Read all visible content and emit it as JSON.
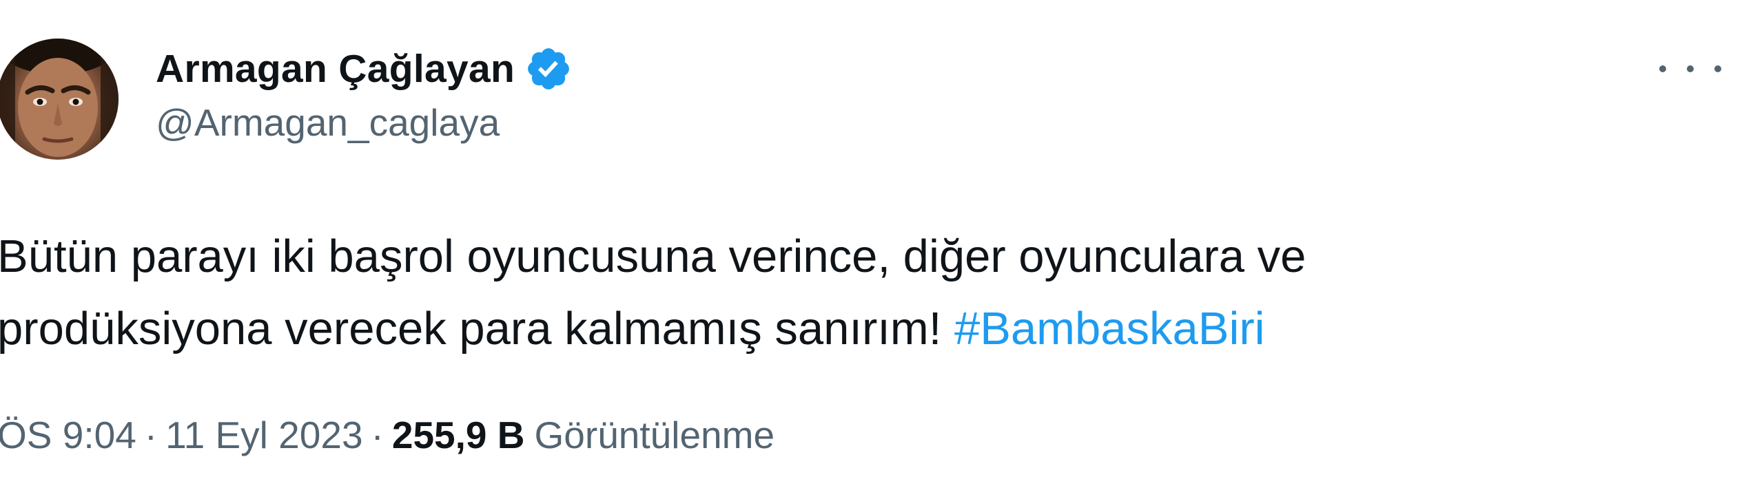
{
  "tweet": {
    "author": {
      "display_name": "Armagan Çağlayan",
      "handle": "@Armagan_caglaya",
      "verified": true,
      "verified_color": "#1d9bf0"
    },
    "more_icon": "more-horizontal-icon",
    "text": {
      "line1": "Bütün parayı iki başrol oyuncusuna verince, diğer oyunculara ve",
      "line2_prefix": "prodüksiyona verecek para kalmamış sanırım! ",
      "hashtag": "#BambaskaBiri"
    },
    "meta": {
      "time": "ÖS 9:04",
      "separator": "·",
      "date": "11 Eyl 2023",
      "views_count": "255,9 B",
      "views_label": "Görüntülenme"
    },
    "colors": {
      "text": "#0f1419",
      "secondary": "#536471",
      "link": "#1d9bf0"
    }
  }
}
